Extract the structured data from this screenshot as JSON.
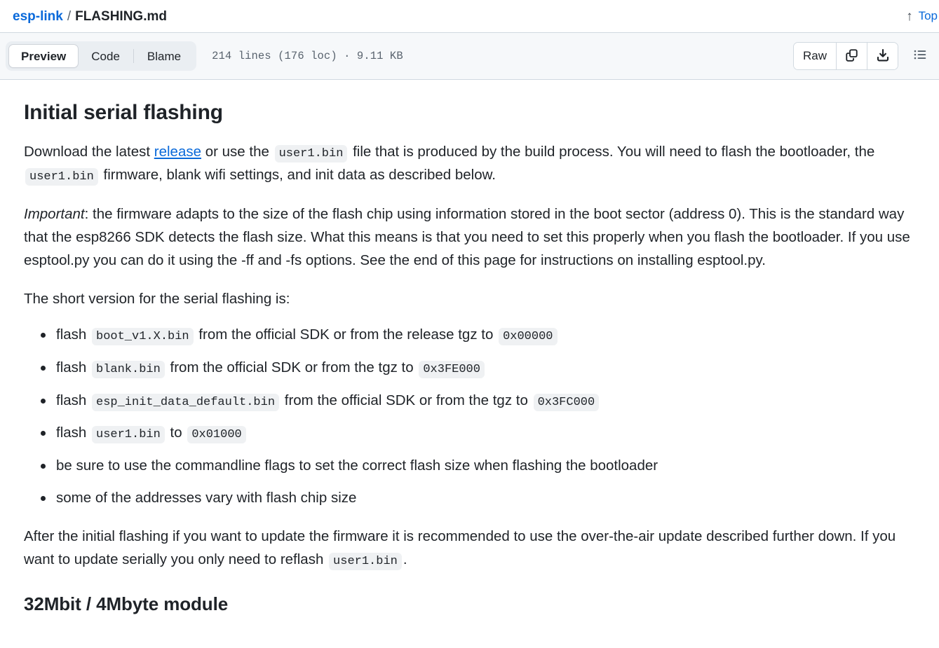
{
  "header": {
    "repo": "esp-link",
    "separator": "/",
    "file_name": "FLASHING.md",
    "top_label": "Top",
    "arrow_up_glyph": "↑"
  },
  "toolbar": {
    "tabs": [
      {
        "label": "Preview",
        "active": true
      },
      {
        "label": "Code",
        "active": false
      },
      {
        "label": "Blame",
        "active": false
      }
    ],
    "file_meta": "214 lines (176 loc) · 9.11 KB",
    "raw_label": "Raw",
    "copy_icon": "copy-icon",
    "download_icon": "download-icon",
    "toc_icon": "list-unordered-icon"
  },
  "colors": {
    "link": "#0969da",
    "text": "#1f2328",
    "muted": "#59636e",
    "toolbar_bg": "#f6f8fa",
    "segmented_bg": "#eaeef2",
    "border": "#d1d9e0",
    "code_bg": "#eff1f3"
  },
  "document": {
    "h1": "Initial serial flashing",
    "p1": {
      "part1": "Download the latest ",
      "link": "release",
      "part2": " or use the ",
      "code1": "user1.bin",
      "part3": " file that is produced by the build process. You will need to flash the bootloader, the ",
      "code2": "user1.bin",
      "part4": " firmware, blank wifi settings, and init data as described below."
    },
    "p2": {
      "emphasis": "Important",
      "rest": ": the firmware adapts to the size of the flash chip using information stored in the boot sector (address 0). This is the standard way that the esp8266 SDK detects the flash size. What this means is that you need to set this properly when you flash the bootloader. If you use esptool.py you can do it using the -ff and -fs options. See the end of this page for instructions on installing esptool.py."
    },
    "p3": "The short version for the serial flashing is:",
    "list": [
      {
        "pre": "flash ",
        "code": "boot_v1.X.bin",
        "mid": " from the official SDK or from the release tgz to ",
        "code2": "0x00000",
        "post": ""
      },
      {
        "pre": "flash ",
        "code": "blank.bin",
        "mid": " from the official SDK or from the tgz to ",
        "code2": "0x3FE000",
        "post": ""
      },
      {
        "pre": "flash ",
        "code": "esp_init_data_default.bin",
        "mid": " from the official SDK or from the tgz to ",
        "code2": "0x3FC000",
        "post": ""
      },
      {
        "pre": "flash ",
        "code": "user1.bin",
        "mid": " to ",
        "code2": "0x01000",
        "post": ""
      },
      {
        "pre": "be sure to use the commandline flags to set the correct flash size when flashing the bootloader",
        "code": "",
        "mid": "",
        "code2": "",
        "post": ""
      },
      {
        "pre": "some of the addresses vary with flash chip size",
        "code": "",
        "mid": "",
        "code2": "",
        "post": ""
      }
    ],
    "p4": {
      "part1": "After the initial flashing if you want to update the firmware it is recommended to use the over-the-air update described further down. If you want to update serially you only need to reflash ",
      "code": "user1.bin",
      "part2": "."
    },
    "h2": "32Mbit / 4Mbyte module"
  }
}
